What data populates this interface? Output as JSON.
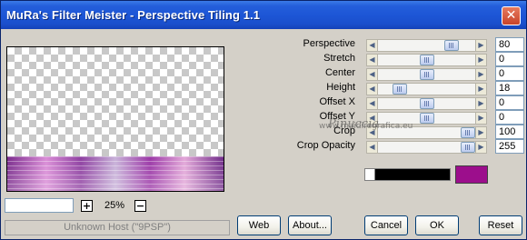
{
  "window": {
    "title": "MuRa's Filter Meister - Perspective Tiling 1.1",
    "close_glyph": "✕"
  },
  "preview": {
    "zoom_value": "",
    "zoom_in_glyph": "+",
    "zoom_out_glyph": "−",
    "zoom_label": "25%"
  },
  "status_text": "Unknown Host (\"9PSP\")",
  "sliders": [
    {
      "label": "Perspective",
      "value": "80",
      "level": 0.8
    },
    {
      "label": "Stretch",
      "value": "0",
      "level": 0.5
    },
    {
      "label": "Center",
      "value": "0",
      "level": 0.5
    },
    {
      "label": "Height",
      "value": "18",
      "level": 0.18
    },
    {
      "label": "Offset X",
      "value": "0",
      "level": 0.5
    },
    {
      "label": "Offset Y",
      "value": "0",
      "level": 0.5
    },
    {
      "label": "Crop",
      "value": "100",
      "level": 1.0
    },
    {
      "label": "Crop Opacity",
      "value": "255",
      "level": 1.0
    }
  ],
  "slider_arrows": {
    "left": "◀",
    "right": "▶"
  },
  "colors": {
    "swatch": "#9c0e8c",
    "gradient_bar": "#000000"
  },
  "watermark": {
    "line1": "Pinuccia",
    "line2": "www.maidiregrafica.eu"
  },
  "buttons": {
    "web": "Web",
    "about": "About...",
    "cancel": "Cancel",
    "ok": "OK",
    "reset": "Reset"
  }
}
